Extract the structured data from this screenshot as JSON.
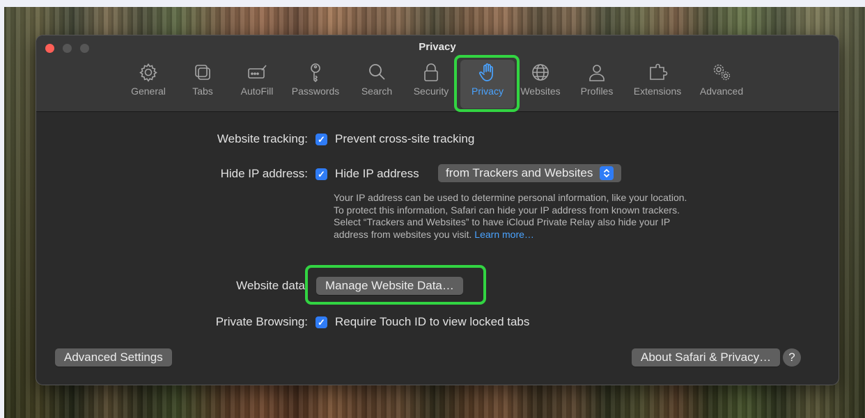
{
  "window": {
    "title": "Privacy"
  },
  "toolbar": {
    "items": [
      {
        "label": "General",
        "icon": "gear-icon"
      },
      {
        "label": "Tabs",
        "icon": "tabs-icon"
      },
      {
        "label": "AutoFill",
        "icon": "autofill-icon"
      },
      {
        "label": "Passwords",
        "icon": "key-icon"
      },
      {
        "label": "Search",
        "icon": "magnifier-icon"
      },
      {
        "label": "Security",
        "icon": "lock-icon"
      },
      {
        "label": "Privacy",
        "icon": "hand-icon",
        "selected": true
      },
      {
        "label": "Websites",
        "icon": "globe-icon"
      },
      {
        "label": "Profiles",
        "icon": "person-icon"
      },
      {
        "label": "Extensions",
        "icon": "puzzle-icon"
      },
      {
        "label": "Advanced",
        "icon": "gears-icon"
      }
    ]
  },
  "settings": {
    "website_tracking": {
      "label": "Website tracking:",
      "checkbox_label": "Prevent cross-site tracking",
      "checked": true
    },
    "hide_ip": {
      "label": "Hide IP address:",
      "checkbox_label": "Hide IP address",
      "checked": true,
      "popup_value": "from Trackers and Websites",
      "help_text": "Your IP address can be used to determine personal information, like your location. To protect this information, Safari can hide your IP address from known trackers. Select “Trackers and Websites” to have iCloud Private Relay also hide your IP address from websites you visit.",
      "learn_more": "Learn more…"
    },
    "website_data": {
      "label": "Website data",
      "button": "Manage Website Data…"
    },
    "private_browsing": {
      "label": "Private Browsing:",
      "checkbox_label": "Require Touch ID to view locked tabs",
      "checked": true
    }
  },
  "footer": {
    "advanced_button": "Advanced Settings",
    "about_button": "About Safari & Privacy…",
    "help_button": "?"
  },
  "colors": {
    "accent": "#2f7cf6",
    "selected_tab": "#4aa3ff",
    "highlight": "#32d442",
    "window_bg": "#2b2b2b"
  }
}
